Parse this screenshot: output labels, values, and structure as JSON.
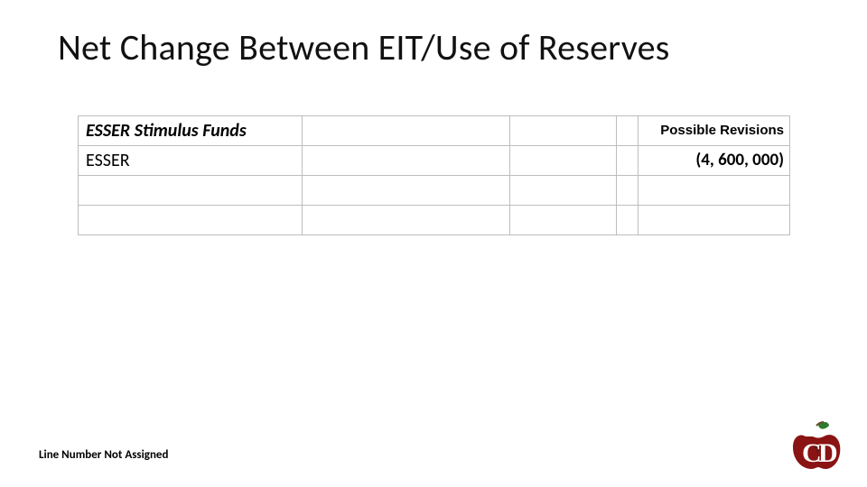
{
  "title": "Net Change Between EIT/Use of Reserves",
  "table": {
    "header": {
      "label": "ESSER Stimulus Funds",
      "col2": "",
      "col3": "",
      "col4": "",
      "col5": "Possible Revisions"
    },
    "rows": [
      {
        "label": "ESSER",
        "c2": "",
        "c3": "",
        "c4": "",
        "amount": "(4, 600, 000)"
      },
      {
        "label": "",
        "c2": "",
        "c3": "",
        "c4": "",
        "amount": ""
      },
      {
        "label": "",
        "c2": "",
        "c3": "",
        "c4": "",
        "amount": ""
      }
    ]
  },
  "footnote": "Line Number Not Assigned",
  "logo": {
    "letters": "CD"
  },
  "chart_data": {
    "type": "table",
    "title": "Net Change Between EIT/Use of Reserves",
    "columns": [
      "ESSER Stimulus Funds",
      "",
      "",
      "",
      "Possible Revisions"
    ],
    "rows": [
      [
        "ESSER",
        "",
        "",
        "",
        -4600000
      ]
    ]
  }
}
